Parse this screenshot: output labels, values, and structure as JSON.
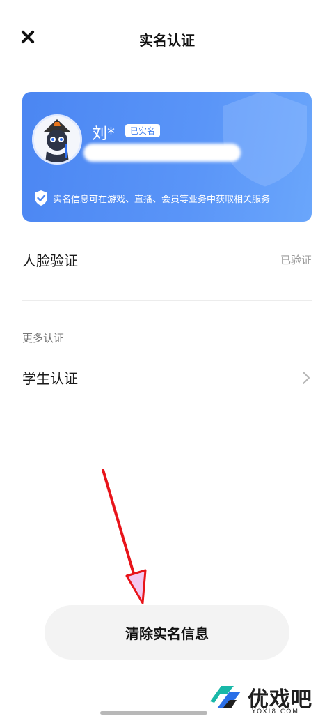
{
  "header": {
    "title": "实名认证"
  },
  "profile_card": {
    "name": "刘*",
    "badge": "已实名",
    "note": "实名信息可在游戏、直播、会员等业务中获取相关服务"
  },
  "face_verification": {
    "label": "人脸验证",
    "status": "已验证"
  },
  "more_section": {
    "label": "更多认证",
    "student": {
      "label": "学生认证"
    }
  },
  "clear_button": {
    "label": "清除实名信息"
  },
  "watermark": {
    "text": "优戏吧",
    "sub": "YOXI8.COM"
  },
  "colors": {
    "card_blue": "#4b86f2",
    "arrow_red": "#e8141a"
  }
}
